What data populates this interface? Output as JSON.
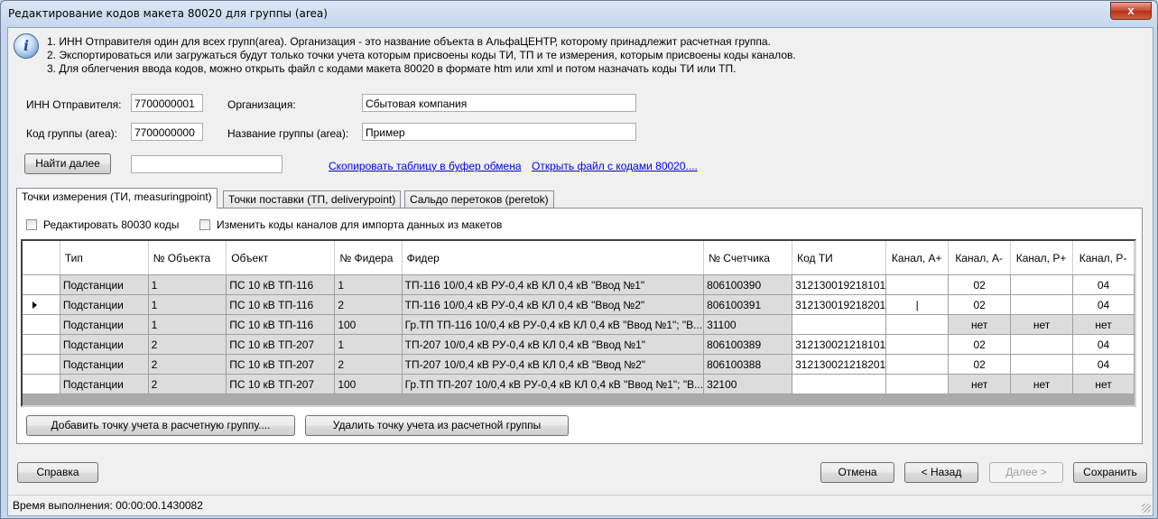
{
  "window": {
    "title": "Редактирование кодов макета 80020 для группы (area)",
    "close_glyph": "x"
  },
  "info": {
    "icon": "i",
    "lines": [
      "1. ИНН Отправителя один для всех групп(area). Организация - это название объекта в АльфаЦЕНТР, которому принадлежит расчетная группа.",
      "2. Экспортироваться или загружаться будут только точки учета которым присвоены коды ТИ, ТП и те измерения, которым присвоены коды каналов.",
      "3. Для облегчения ввода кодов, можно открыть файл с кодами макета 80020 в формате htm или xml и потом назначать коды ТИ или ТП."
    ]
  },
  "form": {
    "inn_label": "ИНН Отправителя:",
    "inn_value": "7700000001",
    "org_label": "Организация:",
    "org_value": "Сбытовая компания",
    "group_code_label": "Код группы (area):",
    "group_code_value": "7700000000",
    "group_name_label": "Название группы (area):",
    "group_name_value": "Пример",
    "find_next_label": "Найти далее",
    "find_value": "",
    "copy_link": "Скопировать таблицу в буфер обмена",
    "open_link": "Открыть файл с кодами 80020...."
  },
  "tabs": [
    {
      "label": "Точки измерения (ТИ, measuringpoint)",
      "active": true
    },
    {
      "label": "Точки поставки (ТП, deliverypoint)",
      "active": false
    },
    {
      "label": "Сальдо перетоков (peretok)",
      "active": false
    }
  ],
  "options": {
    "edit_80030": "Редактировать 80030 коды",
    "change_channel_codes": "Изменить коды каналов для импорта данных из макетов"
  },
  "table": {
    "columns": [
      "Тип",
      "№ Объекта",
      "Объект",
      "№ Фидера",
      "Фидер",
      "№ Счетчика",
      "Код ТИ",
      "Канал, А+",
      "Канал, А-",
      "Канал, Р+",
      "Канал, Р-"
    ],
    "rows": [
      [
        "Подстанции",
        "1",
        "ПС 10 кВ ТП-116",
        "1",
        "ТП-116 10/0,4 кВ РУ-0,4 кВ КЛ 0,4 кВ \"Ввод №1\"",
        "806100390",
        "312130019218101",
        "",
        "02",
        "",
        "04"
      ],
      [
        "Подстанции",
        "1",
        "ПС 10 кВ ТП-116",
        "2",
        "ТП-116 10/0,4 кВ РУ-0,4 кВ КЛ 0,4 кВ \"Ввод №2\"",
        "806100391",
        "312130019218201",
        "|",
        "02",
        "",
        "04"
      ],
      [
        "Подстанции",
        "1",
        "ПС 10 кВ ТП-116",
        "100",
        "Гр.ТП ТП-116 10/0,4 кВ РУ-0,4 кВ КЛ 0,4 кВ \"Ввод №1\"; \"В...",
        "31100",
        "",
        "",
        "нет",
        "нет",
        "нет"
      ],
      [
        "Подстанции",
        "2",
        "ПС 10 кВ ТП-207",
        "1",
        "ТП-207 10/0,4 кВ РУ-0,4 кВ КЛ 0,4 кВ \"Ввод №1\"",
        "806100389",
        "312130021218101",
        "",
        "02",
        "",
        "04"
      ],
      [
        "Подстанции",
        "2",
        "ПС 10 кВ ТП-207",
        "2",
        "ТП-207 10/0,4 кВ РУ-0,4 кВ КЛ 0,4 кВ \"Ввод №2\"",
        "806100388",
        "312130021218201",
        "",
        "02",
        "",
        "04"
      ],
      [
        "Подстанции",
        "2",
        "ПС 10 кВ ТП-207",
        "100",
        "Гр.ТП ТП-207 10/0,4 кВ РУ-0,4 кВ КЛ 0,4 кВ \"Ввод №1\"; \"В...",
        "32100",
        "",
        "",
        "нет",
        "нет",
        "нет"
      ]
    ],
    "current_row": 1
  },
  "actions": {
    "add_point": "Добавить точку учета в расчетную группу....",
    "remove_point": "Удалить точку учета из расчетной группы"
  },
  "footer": {
    "help": "Справка",
    "cancel": "Отмена",
    "back": "< Назад",
    "next": "Далее >",
    "save": "Сохранить"
  },
  "status": {
    "text": "Время выполнения: 00:00:00.1430082"
  }
}
